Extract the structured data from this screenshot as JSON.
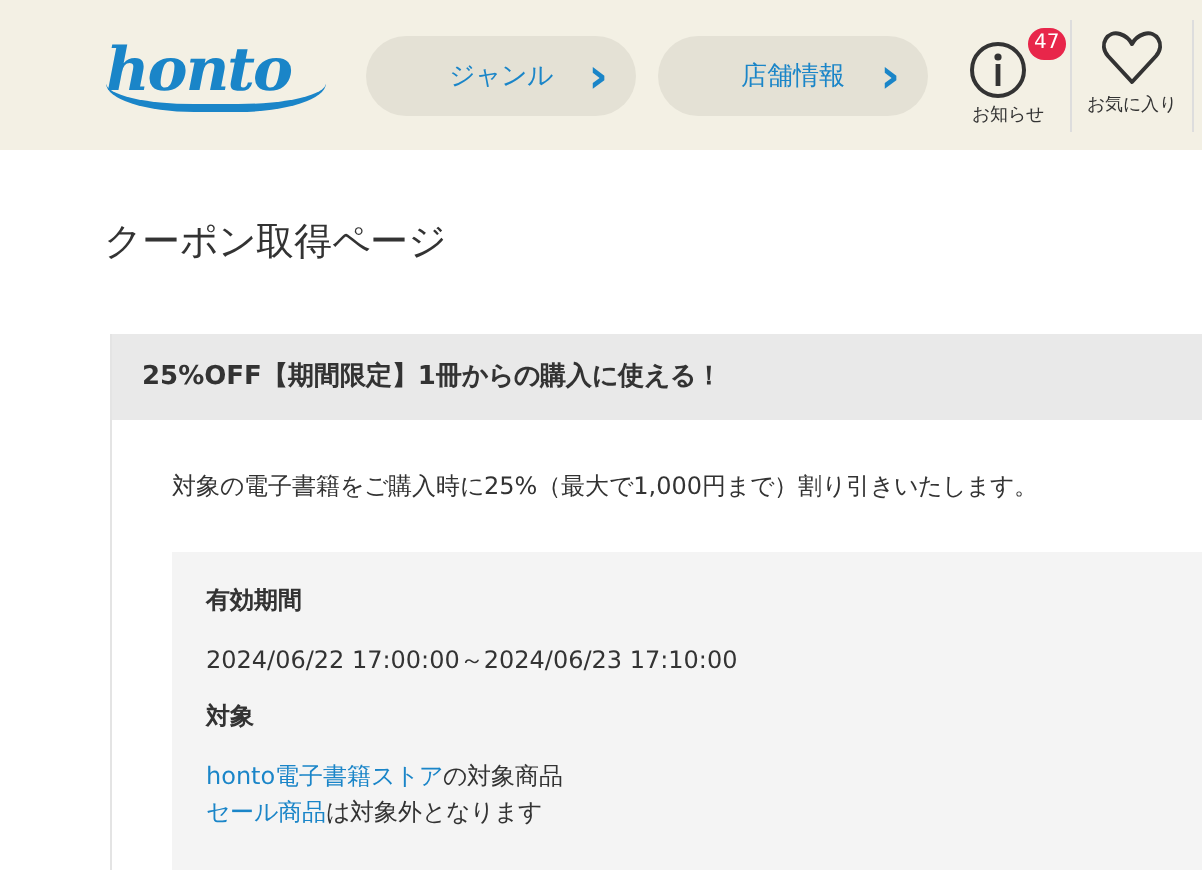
{
  "header": {
    "logo": "honto",
    "nav": [
      {
        "label": "ジャンル",
        "arrow": "›"
      },
      {
        "label": "店舗情報",
        "arrow": "›"
      }
    ],
    "notifications": {
      "label": "お知らせ",
      "badge": "47"
    },
    "favorites": {
      "label": "お気に入り"
    }
  },
  "page_title": "クーポン取得ページ",
  "coupon": {
    "title": "25%OFF【期間限定】1冊からの購入に使える！",
    "description": "対象の電子書籍をご購入時に25%（最大で1,000円まで）割り引きいたします。",
    "details": [
      {
        "kind": "text",
        "heading": "有効期間",
        "lines": [
          {
            "text": "2024/06/22 17:00:00～2024/06/23 17:10:00"
          }
        ]
      },
      {
        "kind": "links",
        "heading": "対象",
        "lines": [
          {
            "link": "honto電子書籍ストア",
            "text": "の対象商品"
          },
          {
            "link": "セール商品",
            "text": "は対象外となります"
          }
        ]
      }
    ]
  }
}
